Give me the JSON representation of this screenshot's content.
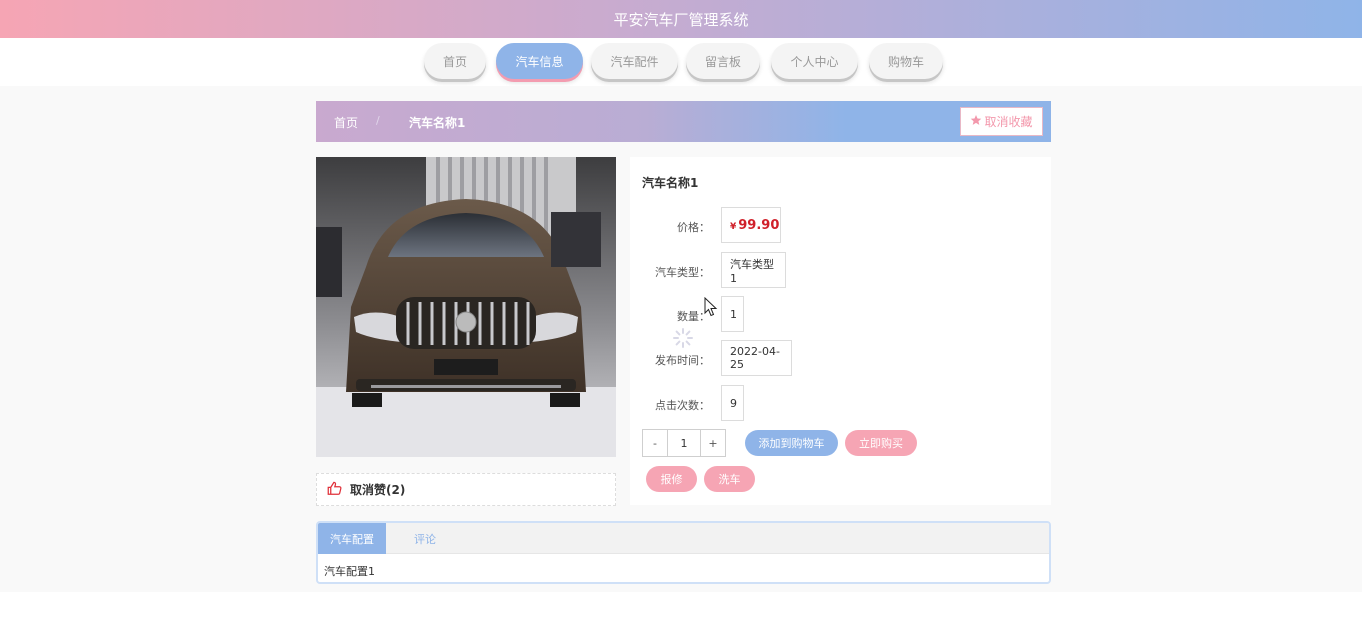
{
  "header": {
    "title": "平安汽车厂管理系统"
  },
  "nav": {
    "items": [
      {
        "label": "首页",
        "active": false
      },
      {
        "label": "汽车信息",
        "active": true
      },
      {
        "label": "汽车配件",
        "active": false
      },
      {
        "label": "留言板",
        "active": false
      },
      {
        "label": "个人中心",
        "active": false
      },
      {
        "label": "购物车",
        "active": false
      }
    ]
  },
  "breadcrumb": {
    "home": "首页",
    "separator": "/",
    "current": "汽车名称1"
  },
  "favorite_button": {
    "label": "取消收藏"
  },
  "like": {
    "label": "取消赞(2)"
  },
  "product": {
    "name": "汽车名称1",
    "price_label": "价格：",
    "currency": "¥",
    "price": "99.90",
    "type_label": "汽车类型：",
    "type": "汽车类型1",
    "quantity_label": "数量：",
    "quantity": "1",
    "date_label": "发布时间：",
    "date": "2022-04-25",
    "clicks_label": "点击次数：",
    "clicks": "9"
  },
  "stepper": {
    "minus": "-",
    "value": "1",
    "plus": "+"
  },
  "actions": {
    "add_cart": "添加到购物车",
    "buy_now": "立即购买",
    "repair": "报修",
    "wash": "洗车"
  },
  "tabs": {
    "items": [
      {
        "label": "汽车配置"
      },
      {
        "label": "评论"
      }
    ],
    "content": "汽车配置1"
  },
  "colors": {
    "accent_blue": "#8fb4e8",
    "accent_pink": "#f6a5b4",
    "price_red": "#d0202a"
  }
}
